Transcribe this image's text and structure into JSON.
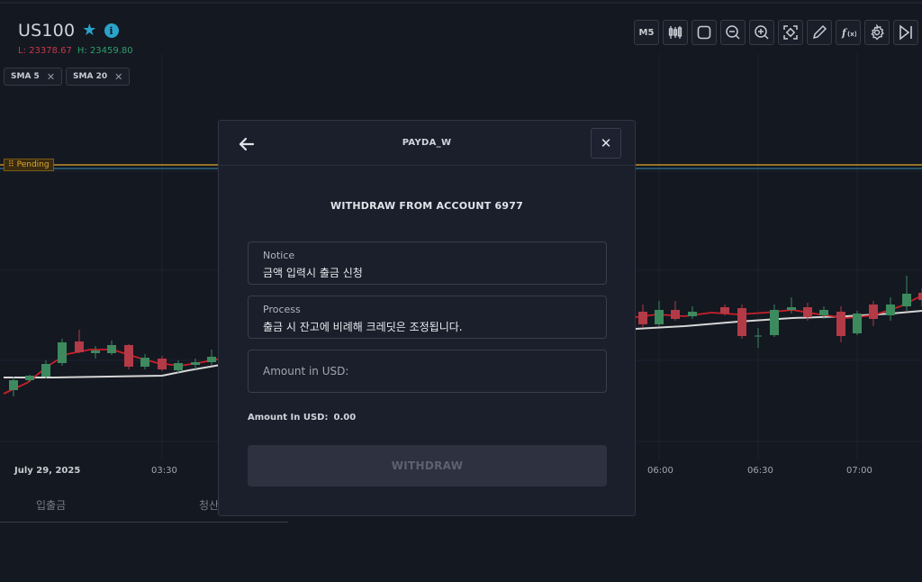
{
  "symbol": {
    "name": "US100",
    "low_label": "L:",
    "low_value": "23378.67",
    "high_label": "H:",
    "high_value": "23459.80"
  },
  "indicators": [
    {
      "label": "SMA 5"
    },
    {
      "label": "SMA 20"
    }
  ],
  "toolbar": {
    "timeframe_label": "M5",
    "icons": [
      "candles-icon",
      "square-icon",
      "zoom-out-icon",
      "zoom-in-icon",
      "fit-screen-icon",
      "pencil-icon",
      "function-icon",
      "gear-icon",
      "skip-end-icon"
    ]
  },
  "pending_label": "Pending",
  "time_axis": {
    "date_label": "July 29, 2025",
    "ticks": [
      "03:30",
      "06:00",
      "06:30",
      "07:00"
    ]
  },
  "bottom_tabs": [
    "입출금",
    "청산"
  ],
  "modal": {
    "title": "PAYDA_W",
    "heading": "WITHDRAW FROM ACCOUNT 6977",
    "notice_label": "Notice",
    "notice_value": "금액 입력시 출금 신청",
    "process_label": "Process",
    "process_value": "출금 시 잔고에 비례해 크레딧은 조정됩니다.",
    "amount_placeholder": "Amount in USD:",
    "amount_summary_label": "Amount In USD:",
    "amount_summary_value": "0.00",
    "withdraw_label": "WITHDRAW"
  },
  "colors": {
    "background": "#141821",
    "bull": "#3d8a5f",
    "bear": "#b33a47",
    "sma_fast": "#c8202a",
    "sma_slow": "#d6d6d6",
    "pending_line": "#e0a82e",
    "accent": "#2aa3c9"
  }
}
